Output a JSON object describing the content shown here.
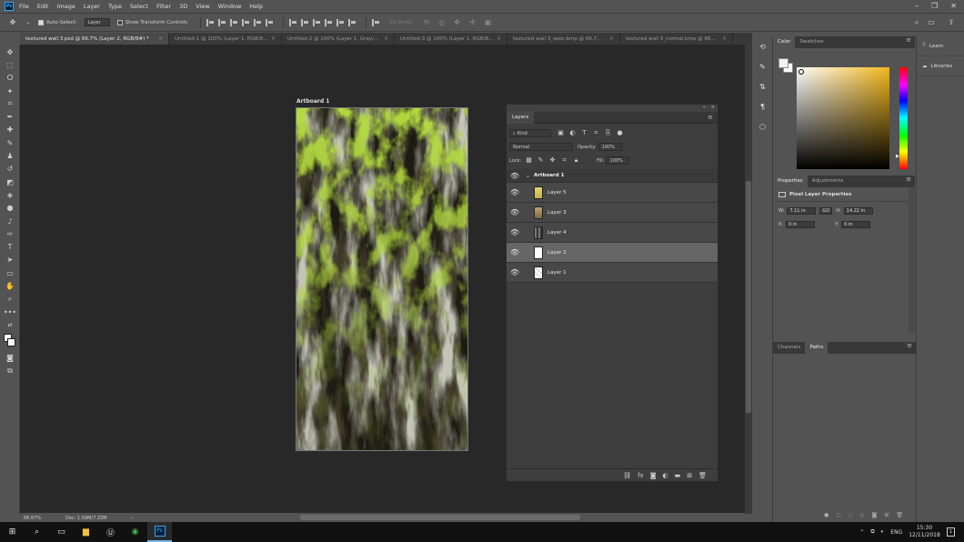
{
  "app": {
    "logo": "Ps"
  },
  "menu": [
    "File",
    "Edit",
    "Image",
    "Layer",
    "Type",
    "Select",
    "Filter",
    "3D",
    "View",
    "Window",
    "Help"
  ],
  "window_controls": [
    "–",
    "❐",
    "✕"
  ],
  "options": {
    "auto_select_label": "Auto-Select:",
    "auto_select_value": "Layer",
    "transform_label": "Show Transform Controls",
    "mode_3d": "3D Mode:"
  },
  "tabs": [
    {
      "label": "textured wall 3.psd @ 66.7% (Layer 2, RGB/8#) *"
    },
    {
      "label": "Untitled-1 @ 100% (Layer 1, RGB/8..."
    },
    {
      "label": "Untitled-2 @ 100% (Layer 1, Gray/..."
    },
    {
      "label": "Untitled-3 @ 100% (Layer 1, RGB/8..."
    },
    {
      "label": "textured wall 3_spec.bmp @ 66.7..."
    },
    {
      "label": "textured wall 3_normal.bmp @ 66..."
    }
  ],
  "artboard_label": "Artboard 1",
  "status": {
    "zoom": "66.67%",
    "doc": "Doc: 1.59M/7.33M",
    "arrow": "›"
  },
  "layers_panel": {
    "title": "Layers",
    "filter_kind": "Kind",
    "blend_mode": "Normal",
    "opacity_label": "Opacity:",
    "opacity_value": "100%",
    "lock_label": "Lock:",
    "fill_label": "Fill:",
    "fill_value": "100%",
    "group_name": "Artboard 1",
    "layers": [
      {
        "name": "Layer 5"
      },
      {
        "name": "Layer 3"
      },
      {
        "name": "Layer 4"
      },
      {
        "name": "Layer 2"
      },
      {
        "name": "Layer 1"
      }
    ],
    "selected_index": 3
  },
  "color_panel": {
    "tabs": [
      "Color",
      "Swatches"
    ],
    "hue_color": "#f3b71b"
  },
  "properties_panel": {
    "tabs": [
      "Properties",
      "Adjustments"
    ],
    "heading": "Pixel Layer Properties",
    "w_label": "W:",
    "w_value": "7.11 in",
    "link": "GO",
    "h_label": "H:",
    "h_value": "14.22 in",
    "x_label": "X:",
    "x_value": "0 in",
    "y_label": "Y:",
    "y_value": "0 in"
  },
  "channels_panel": {
    "tabs": [
      "Channels",
      "Paths"
    ]
  },
  "learn_panel": {
    "learn": "Learn",
    "libraries": "Libraries"
  },
  "taskbar": {
    "lang": "ENG",
    "time": "15:30",
    "date": "12/11/2018",
    "notif": "1"
  }
}
